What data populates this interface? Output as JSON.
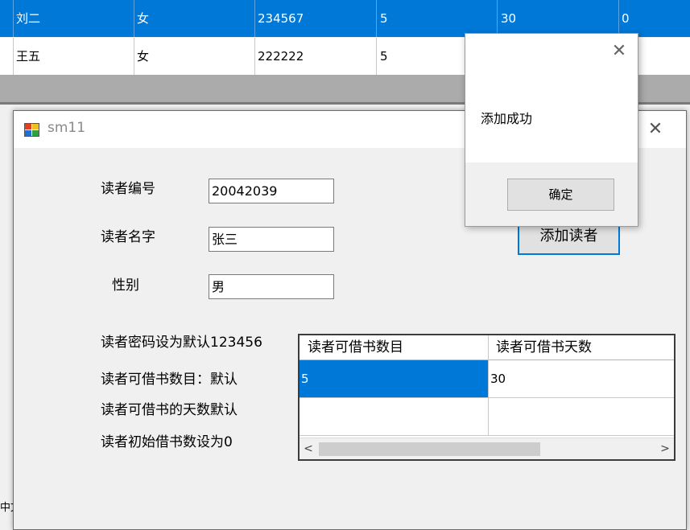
{
  "background_table": {
    "rows": [
      {
        "name": "刘二",
        "gender": "女",
        "phone": "234567",
        "books": "5",
        "days": "30",
        "borrowed": "0"
      },
      {
        "name": "王五",
        "gender": "女",
        "phone": "222222",
        "books": "5"
      }
    ],
    "bottom_text": "中文"
  },
  "window": {
    "title": "sm11",
    "close_icon": "close-icon",
    "labels": {
      "reader_id": "读者编号",
      "reader_name": "读者名字",
      "gender": "性别"
    },
    "fields": {
      "reader_id": "20042039",
      "reader_name": "张三",
      "gender": "男"
    },
    "add_button": "添加读者",
    "notes": [
      "读者密码设为默认123456",
      "读者可借书数目：默认",
      "读者可借书的天数默认",
      "读者初始借书数设为0"
    ],
    "grid": {
      "columns": [
        "读者可借书数目",
        "读者可借书天数"
      ],
      "rows": [
        [
          "5",
          "30"
        ],
        [
          "",
          ""
        ]
      ]
    }
  },
  "message_box": {
    "text": "添加成功",
    "ok_label": "确定",
    "close_icon": "close-icon"
  },
  "colors": {
    "selection": "#0078d7",
    "focus_border": "#0078d7"
  }
}
